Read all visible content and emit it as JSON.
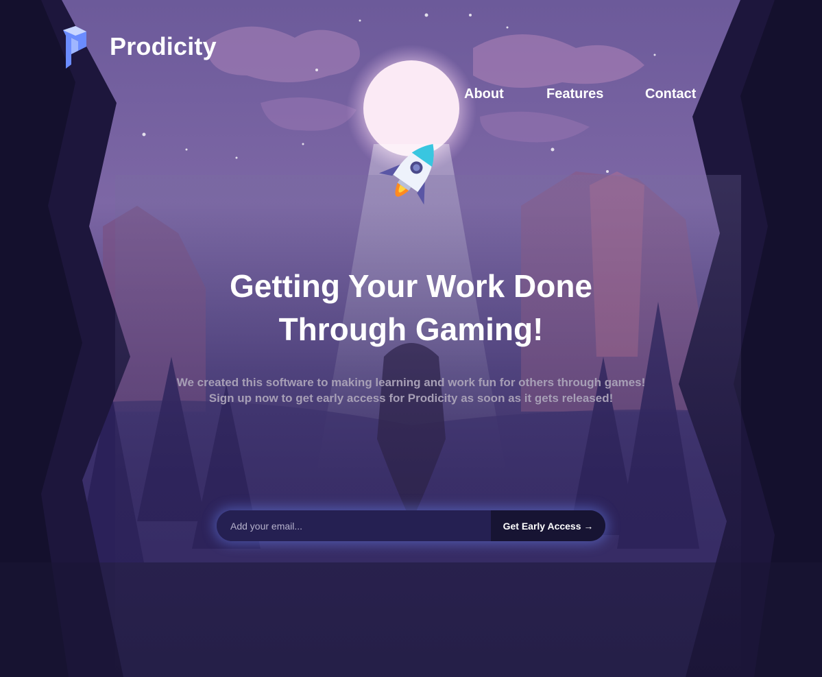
{
  "brand": {
    "name": "Prodicity",
    "logo_icon": "prodicity-logo-icon",
    "logo_color": "#6b8cff"
  },
  "nav": {
    "items": [
      {
        "label": "About"
      },
      {
        "label": "Features"
      },
      {
        "label": "Contact"
      }
    ]
  },
  "hero": {
    "headline": [
      "Getting Your Work Done",
      "Through Gaming!"
    ],
    "subtitle": [
      "We created this software to making learning and work fun for others through games!",
      "Sign up now to get early access for Prodicity as soon as it gets released!"
    ],
    "rocket_icon": "rocket-icon"
  },
  "signup": {
    "email_placeholder": "Add your email...",
    "button_label": "Get Early Access →"
  },
  "colors": {
    "sky_top": "#6c5a9a",
    "background_dark": "#1a1535",
    "input_bg": "#252052",
    "button_bg": "#171433",
    "glow": "#6e8cff",
    "subtitle_text": "#a79fb6"
  }
}
